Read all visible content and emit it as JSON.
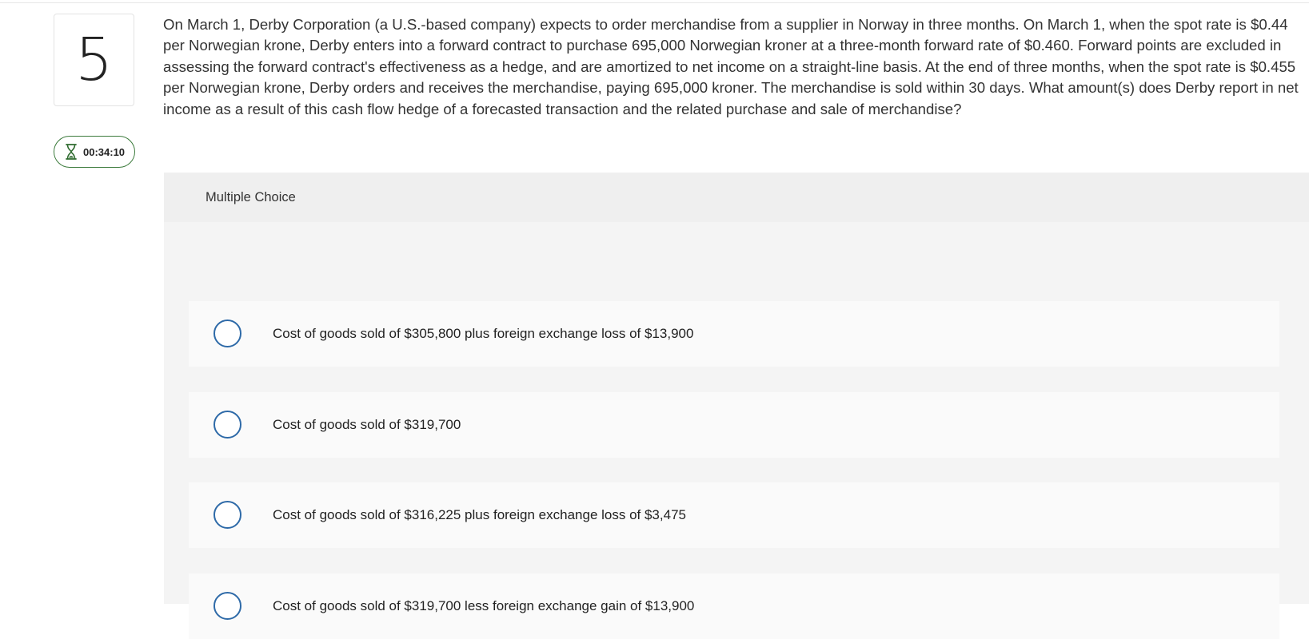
{
  "question": {
    "number": "5",
    "text": "On March 1, Derby Corporation (a U.S.-based company) expects to order merchandise from a supplier in Norway in three months. On March 1, when the spot rate is $0.44 per Norwegian krone, Derby enters into a forward contract to purchase 695,000 Norwegian kroner at a three-month forward rate of $0.460. Forward points are excluded in assessing the forward contract's effectiveness as a hedge, and are amortized to net income on a straight-line basis. At the end of three months, when the spot rate is $0.455 per Norwegian krone, Derby orders and receives the merchandise, paying 695,000 kroner. The merchandise is sold within 30 days. What amount(s) does Derby report in net income as a result of this cash flow hedge of a forecasted transaction and the related purchase and sale of merchandise?"
  },
  "timer": {
    "icon": "hourglass-icon",
    "value": "00:34:10",
    "color": "#3b7a3b"
  },
  "choices": {
    "header": "Multiple Choice",
    "options": [
      {
        "label": "Cost of goods sold of $305,800 plus foreign exchange loss of $13,900"
      },
      {
        "label": "Cost of goods sold of $319,700"
      },
      {
        "label": "Cost of goods sold of $316,225 plus foreign exchange loss of $3,475"
      },
      {
        "label": "Cost of goods sold of $319,700 less foreign exchange gain of $13,900"
      }
    ],
    "radio_color": "#2e6aa8"
  }
}
